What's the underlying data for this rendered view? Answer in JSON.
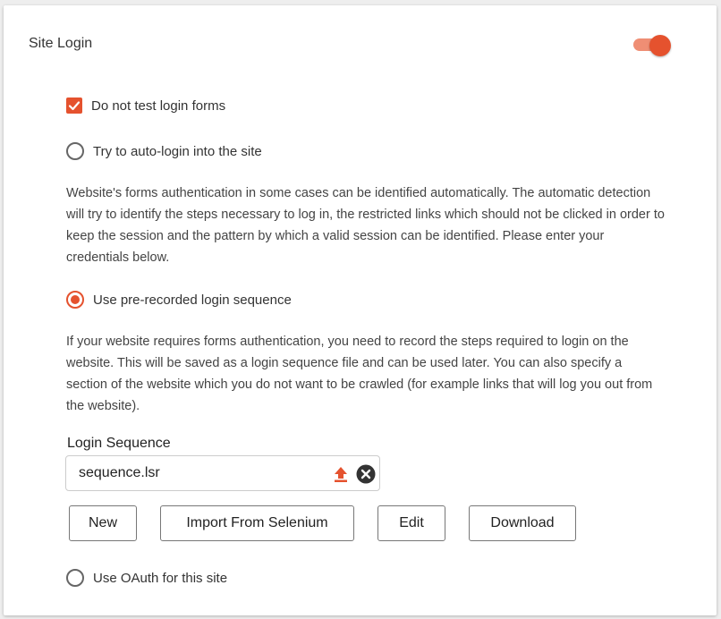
{
  "section": {
    "title": "Site Login",
    "toggle_on": true
  },
  "options": {
    "no_test": {
      "label": "Do not test login forms",
      "checked": true
    },
    "auto_login": {
      "label": "Try to auto-login into the site",
      "selected": false,
      "description": "Website's forms authentication in some cases can be identified automatically. The automatic detection will try to identify the steps necessary to log in, the restricted links which should not be clicked in order to keep the session and the pattern by which a valid session can be identified. Please enter your credentials below."
    },
    "prerecorded": {
      "label": "Use pre-recorded login sequence",
      "selected": true,
      "description": "If your website requires forms authentication, you need to record the steps required to login on the website. This will be saved as a login sequence file and can be used later. You can also specify a section of the website which you do not want to be crawled (for example links that will log you out from the website)."
    },
    "oauth": {
      "label": "Use OAuth for this site",
      "selected": false
    }
  },
  "login_sequence": {
    "label": "Login Sequence",
    "file_name": "sequence.lsr",
    "upload_icon": "upload-icon",
    "clear_icon": "clear-icon"
  },
  "buttons": {
    "new": "New",
    "import": "Import From Selenium",
    "edit": "Edit",
    "download": "Download"
  },
  "colors": {
    "accent": "#e5522e",
    "accent_light": "#ef8e74",
    "dark_icon": "#333333"
  }
}
